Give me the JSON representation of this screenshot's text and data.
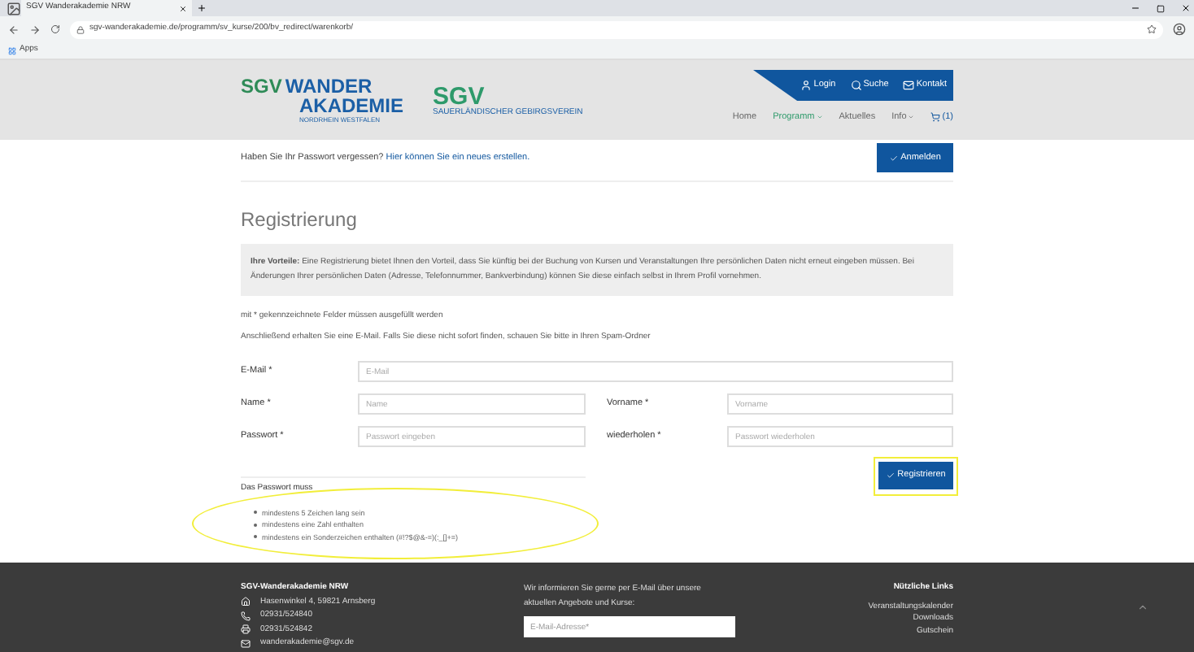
{
  "browser": {
    "tab_title": "SGV Wanderakademie NRW",
    "url": "sgv-wanderakademie.de/programm/sv_kurse/200/bv_redirect/warenkorb/",
    "bookmarks": [
      "Apps"
    ]
  },
  "header": {
    "logo": {
      "line1": "SGV",
      "line2": "WANDER",
      "line3": "AKADEMIE",
      "line4": "NORDRHEIN WESTFALEN"
    },
    "logo2": {
      "text": "SGV",
      "subtitle": "SAUERLÄNDISCHER GEBIRGSVEREIN"
    },
    "top_links": [
      {
        "kind": "user",
        "label": "Login"
      },
      {
        "kind": "search",
        "label": "Suche"
      },
      {
        "kind": "mail",
        "label": "Kontakt"
      }
    ],
    "nav": [
      {
        "label": "Home",
        "selected": false,
        "dropdown": false
      },
      {
        "label": "Programm",
        "selected": true,
        "dropdown": true
      },
      {
        "label": "Aktuelles",
        "selected": false,
        "dropdown": false
      },
      {
        "label": "Info",
        "selected": false,
        "dropdown": true
      },
      {
        "label": "(1)",
        "selected": false,
        "dropdown": false,
        "kind": "cart"
      }
    ]
  },
  "login_bar": {
    "text": "Haben Sie Ihr Passwort vergessen?",
    "link": "Hier können Sie ein neues erstellen.",
    "button": "Anmelden"
  },
  "registration": {
    "title": "Registrierung",
    "info": "**Ihre Vorteile:** Eine Registrierung bietet Ihnen den Vorteil, dass Sie künftig bei der Buchung von Kursen und Veranstaltungen Ihre persönlichen Daten nicht erneut eingeben müssen. Bei Änderungen Ihrer persönlichen Daten (Adresse, Telefonnummer, Bankverbindung) können Sie diese einfach selbst in Ihrem Profil vornehmen.",
    "required_note": "mit * gekennzeichnete Felder müssen ausgefüllt werden",
    "mail_note": "Anschließend erhalten Sie eine E-Mail. Falls Sie diese nicht sofort finden, schauen Sie bitte in Ihren Spam-Ordner",
    "fields": [
      {
        "label": "E-Mail *",
        "placeholder": "E-Mail"
      },
      {
        "label": "Name *",
        "placeholder": "Name"
      },
      {
        "label": "Vorname *",
        "placeholder": "Vorname"
      },
      {
        "label": "Passwort *",
        "placeholder": "Passwort eingeben"
      },
      {
        "label": "wiederholen *",
        "placeholder": "Passwort wiederholen"
      }
    ],
    "password_rules_title": "Das Passwort muss",
    "password_rules": [
      "mindestens 5 Zeichen lang sein",
      "mindestens eine Zahl enthalten",
      "mindestens ein Sonderzeichen enthalten (#!?$@&-=)(:_[]+=)"
    ],
    "button": "Registrieren"
  },
  "footer": {
    "org": "SGV-Wanderakademie NRW",
    "contacts": [
      {
        "kind": "home",
        "text": "Hasenwinkel 4, 59821 Arnsberg"
      },
      {
        "kind": "phone",
        "text": "02931/524840"
      },
      {
        "kind": "fax",
        "text": "02931/524842"
      },
      {
        "kind": "mail",
        "text": "wanderakademie@sgv.de"
      }
    ],
    "newsletter_text": "Wir informieren Sie gerne per E-Mail über unsere aktuellen Angebote und Kurse:",
    "newsletter_placeholder": "E-Mail-Adresse*",
    "links_title": "Nützliche Links",
    "links": [
      "Veranstaltungskalender",
      "Downloads",
      "Gutschein"
    ]
  }
}
